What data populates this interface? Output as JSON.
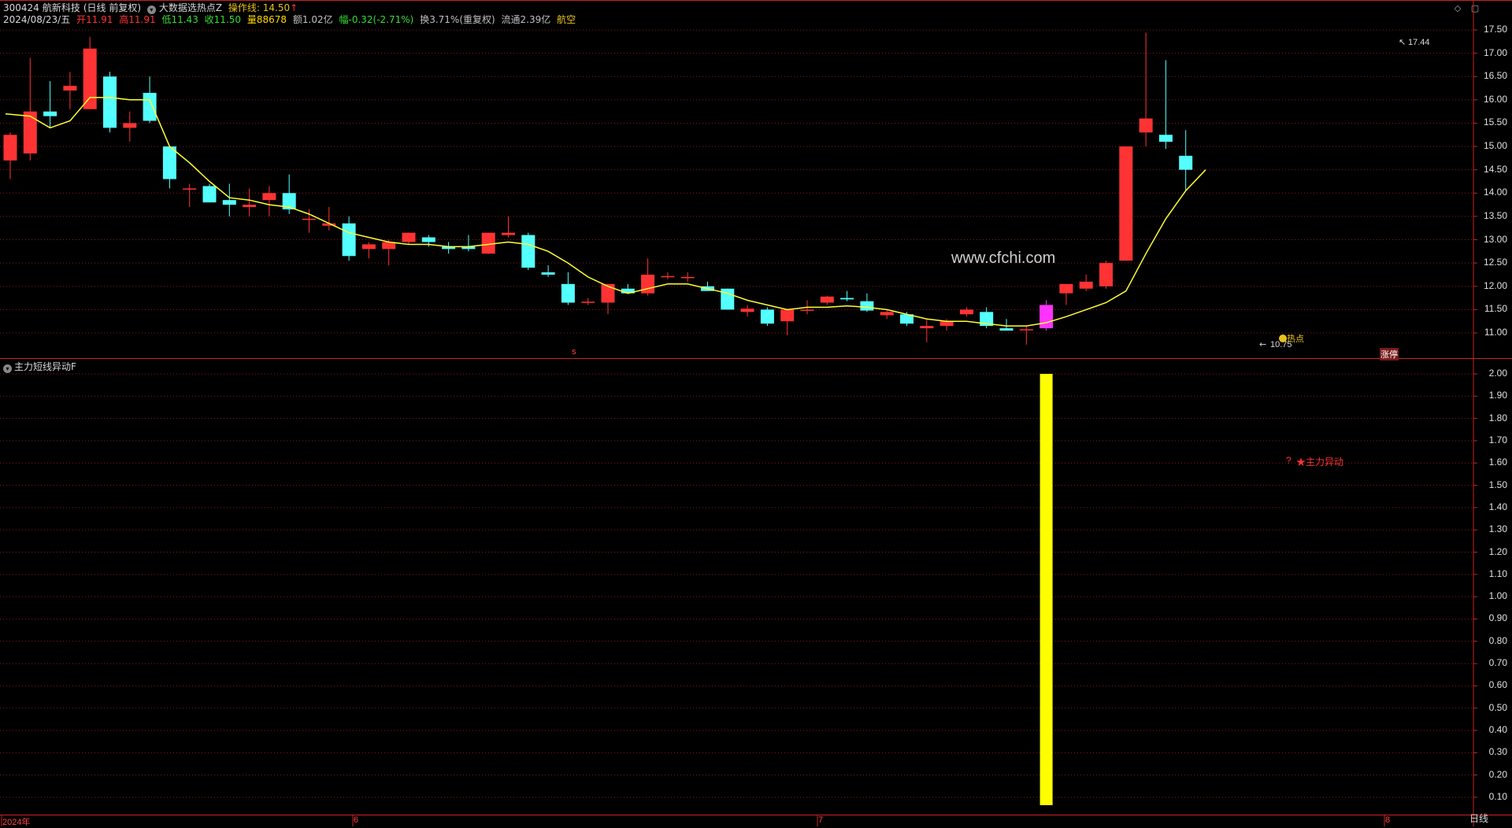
{
  "header": {
    "code": "300424",
    "name": "航新科技",
    "period": "(日线 前复权)",
    "indicator_name": "大数据选热点Z",
    "op_line_label": "操作线:",
    "op_line_value": "14.50",
    "op_line_arrow": "↑"
  },
  "info": {
    "date": "2024/08/23/五",
    "open_label": "开",
    "open": "11.91",
    "high_label": "高",
    "high": "11.91",
    "low_label": "低",
    "low": "11.43",
    "close_label": "收",
    "close": "11.50",
    "vol_label": "量",
    "vol": "88678",
    "amount_label": "额",
    "amount": "1.02亿",
    "change_label": "幅",
    "change": "-0.32(-2.71%)",
    "turnover_label": "换",
    "turnover": "3.71%(重复权)",
    "float_label": "流通",
    "float": "2.39亿",
    "sector": "航空"
  },
  "colors": {
    "up": "#ff3333",
    "down": "#54ffff",
    "ma": "#ffff33",
    "grid": "#8a1a1a",
    "axis": "#cc2222",
    "bar": "#ffff00",
    "magenta": "#ff33ff"
  },
  "price_axis": [
    "17.50",
    "17.00",
    "16.50",
    "16.00",
    "15.50",
    "15.00",
    "14.50",
    "14.00",
    "13.50",
    "13.00",
    "12.50",
    "12.00",
    "11.50",
    "11.00"
  ],
  "ind_axis": [
    "2.00",
    "1.90",
    "1.80",
    "1.70",
    "1.60",
    "1.50",
    "1.40",
    "1.30",
    "1.20",
    "1.10",
    "1.00",
    "0.90",
    "0.80",
    "0.70",
    "0.60",
    "0.50",
    "0.40",
    "0.30",
    "0.20",
    "0.10"
  ],
  "x_axis": [
    "2024年",
    "6",
    "7",
    "8"
  ],
  "watermark": "www.cfchi.com",
  "marks": {
    "high_mark": "17.44",
    "low_mark": "10.75",
    "hot_label": "热点",
    "rise_label": "涨停",
    "s_label": "s",
    "ind_question": "?",
    "ind_label": "★主力异动"
  },
  "indicator_title": "主力短线异动F",
  "bottom_tab": "日线",
  "window_icons": [
    "diamond-icon",
    "maximize-icon"
  ],
  "chart_data": {
    "type": "candlestick",
    "candles": [
      {
        "o": 14.7,
        "h": 15.3,
        "l": 14.3,
        "c": 15.25
      },
      {
        "o": 14.85,
        "h": 16.9,
        "l": 14.7,
        "c": 15.75
      },
      {
        "o": 15.75,
        "h": 16.4,
        "l": 15.4,
        "c": 15.65
      },
      {
        "o": 16.2,
        "h": 16.6,
        "l": 15.8,
        "c": 16.3
      },
      {
        "o": 15.8,
        "h": 17.35,
        "l": 15.8,
        "c": 17.1
      },
      {
        "o": 16.5,
        "h": 16.6,
        "l": 15.3,
        "c": 15.4
      },
      {
        "o": 15.4,
        "h": 15.75,
        "l": 15.1,
        "c": 15.5
      },
      {
        "o": 16.15,
        "h": 16.5,
        "l": 15.5,
        "c": 15.55
      },
      {
        "o": 15.0,
        "h": 15.0,
        "l": 14.1,
        "c": 14.3
      },
      {
        "o": 14.1,
        "h": 14.2,
        "l": 13.7,
        "c": 14.1
      },
      {
        "o": 14.15,
        "h": 14.2,
        "l": 13.8,
        "c": 13.8
      },
      {
        "o": 13.85,
        "h": 14.2,
        "l": 13.5,
        "c": 13.75
      },
      {
        "o": 13.7,
        "h": 14.1,
        "l": 13.5,
        "c": 13.75
      },
      {
        "o": 13.85,
        "h": 14.15,
        "l": 13.5,
        "c": 14.0
      },
      {
        "o": 14.0,
        "h": 14.4,
        "l": 13.55,
        "c": 13.65
      },
      {
        "o": 13.45,
        "h": 13.65,
        "l": 13.15,
        "c": 13.45
      },
      {
        "o": 13.3,
        "h": 13.7,
        "l": 13.2,
        "c": 13.35
      },
      {
        "o": 13.35,
        "h": 13.5,
        "l": 12.55,
        "c": 12.65
      },
      {
        "o": 12.8,
        "h": 12.95,
        "l": 12.6,
        "c": 12.9
      },
      {
        "o": 12.8,
        "h": 13.0,
        "l": 12.45,
        "c": 12.95
      },
      {
        "o": 12.95,
        "h": 13.15,
        "l": 12.9,
        "c": 13.15
      },
      {
        "o": 13.05,
        "h": 13.1,
        "l": 12.85,
        "c": 12.95
      },
      {
        "o": 12.85,
        "h": 12.95,
        "l": 12.7,
        "c": 12.8
      },
      {
        "o": 12.85,
        "h": 13.1,
        "l": 12.75,
        "c": 12.8
      },
      {
        "o": 12.7,
        "h": 13.1,
        "l": 12.7,
        "c": 13.15
      },
      {
        "o": 13.1,
        "h": 13.5,
        "l": 13.05,
        "c": 13.15
      },
      {
        "o": 13.1,
        "h": 13.15,
        "l": 12.35,
        "c": 12.4
      },
      {
        "o": 12.3,
        "h": 12.45,
        "l": 12.2,
        "c": 12.25
      },
      {
        "o": 12.05,
        "h": 12.3,
        "l": 11.6,
        "c": 11.65
      },
      {
        "o": 11.65,
        "h": 11.75,
        "l": 11.6,
        "c": 11.67
      },
      {
        "o": 11.65,
        "h": 12.05,
        "l": 11.4,
        "c": 12.05
      },
      {
        "o": 11.95,
        "h": 12.05,
        "l": 11.85,
        "c": 11.85
      },
      {
        "o": 11.85,
        "h": 12.6,
        "l": 11.8,
        "c": 12.25
      },
      {
        "o": 12.2,
        "h": 12.3,
        "l": 12.15,
        "c": 12.22
      },
      {
        "o": 12.18,
        "h": 12.3,
        "l": 12.1,
        "c": 12.2
      },
      {
        "o": 12.0,
        "h": 12.1,
        "l": 11.9,
        "c": 11.9
      },
      {
        "o": 11.95,
        "h": 11.95,
        "l": 11.5,
        "c": 11.5
      },
      {
        "o": 11.45,
        "h": 11.6,
        "l": 11.35,
        "c": 11.52
      },
      {
        "o": 11.5,
        "h": 11.55,
        "l": 11.15,
        "c": 11.2
      },
      {
        "o": 11.25,
        "h": 11.5,
        "l": 10.95,
        "c": 11.5
      },
      {
        "o": 11.5,
        "h": 11.7,
        "l": 11.4,
        "c": 11.5
      },
      {
        "o": 11.65,
        "h": 11.8,
        "l": 11.6,
        "c": 11.78
      },
      {
        "o": 11.75,
        "h": 11.9,
        "l": 11.68,
        "c": 11.72
      },
      {
        "o": 11.68,
        "h": 11.85,
        "l": 11.45,
        "c": 11.48
      },
      {
        "o": 11.38,
        "h": 11.5,
        "l": 11.3,
        "c": 11.45
      },
      {
        "o": 11.4,
        "h": 11.45,
        "l": 11.15,
        "c": 11.2
      },
      {
        "o": 11.1,
        "h": 11.3,
        "l": 10.8,
        "c": 11.15
      },
      {
        "o": 11.15,
        "h": 11.3,
        "l": 11.05,
        "c": 11.25
      },
      {
        "o": 11.4,
        "h": 11.55,
        "l": 11.35,
        "c": 11.5
      },
      {
        "o": 11.45,
        "h": 11.55,
        "l": 11.1,
        "c": 11.15
      },
      {
        "o": 11.1,
        "h": 11.3,
        "l": 11.05,
        "c": 11.05
      },
      {
        "o": 11.06,
        "h": 11.15,
        "l": 10.75,
        "c": 11.08
      },
      {
        "o": 11.1,
        "h": 11.7,
        "l": 11.05,
        "c": 11.6
      },
      {
        "o": 11.85,
        "h": 12.05,
        "l": 11.6,
        "c": 12.05
      },
      {
        "o": 11.95,
        "h": 12.25,
        "l": 11.9,
        "c": 12.1
      },
      {
        "o": 12.0,
        "h": 12.55,
        "l": 11.95,
        "c": 12.5
      },
      {
        "o": 12.55,
        "h": 15.0,
        "l": 12.55,
        "c": 15.0
      },
      {
        "o": 15.3,
        "h": 17.44,
        "l": 15.0,
        "c": 15.6
      },
      {
        "o": 15.25,
        "h": 16.85,
        "l": 14.95,
        "c": 15.1
      },
      {
        "o": 14.8,
        "h": 15.35,
        "l": 14.05,
        "c": 14.5
      }
    ],
    "ma": [
      15.7,
      15.65,
      15.4,
      15.55,
      16.05,
      16.05,
      16.0,
      16.0,
      15.0,
      14.65,
      14.25,
      13.9,
      13.85,
      13.75,
      13.7,
      13.55,
      13.35,
      13.15,
      13.05,
      12.95,
      12.9,
      12.9,
      12.85,
      12.85,
      12.9,
      12.95,
      12.9,
      12.75,
      12.5,
      12.2,
      12.0,
      11.85,
      11.95,
      12.05,
      12.05,
      11.95,
      11.85,
      11.7,
      11.6,
      11.5,
      11.55,
      11.55,
      11.58,
      11.55,
      11.5,
      11.4,
      11.3,
      11.25,
      11.25,
      11.2,
      11.15,
      11.15,
      11.22,
      11.35,
      11.5,
      11.65,
      11.9,
      12.7,
      13.45,
      14.05,
      14.5
    ],
    "indicator_bar": {
      "index": 52,
      "value": 2.0,
      "ylim": [
        0.1,
        2.0
      ]
    },
    "price_ylim": [
      10.75,
      17.6
    ]
  }
}
